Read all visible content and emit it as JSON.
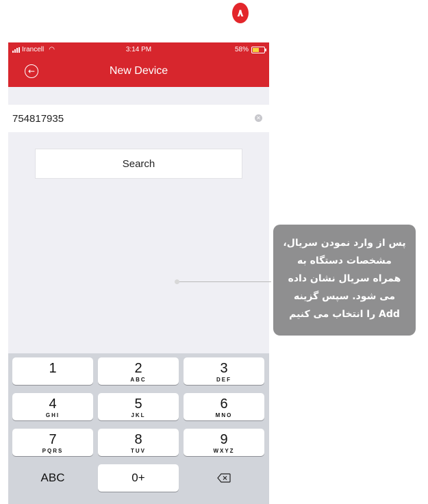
{
  "step_badge": "۸",
  "status_bar": {
    "carrier": "Irancell",
    "time": "3:14 PM",
    "battery": "58%",
    "battery_level": 0.58,
    "wifi_icon": "wifi-icon"
  },
  "nav": {
    "title": "New Device",
    "back_icon": "back-circle-icon"
  },
  "serial_input": {
    "value": "754817935"
  },
  "search_button": {
    "label": "Search"
  },
  "keyboard": {
    "keys": [
      {
        "num": "1",
        "letters": ""
      },
      {
        "num": "2",
        "letters": "ABC"
      },
      {
        "num": "3",
        "letters": "DEF"
      },
      {
        "num": "4",
        "letters": "GHI"
      },
      {
        "num": "5",
        "letters": "JKL"
      },
      {
        "num": "6",
        "letters": "MNO"
      },
      {
        "num": "7",
        "letters": "PQRS"
      },
      {
        "num": "8",
        "letters": "TUV"
      },
      {
        "num": "9",
        "letters": "WXYZ"
      }
    ],
    "abc_label": "ABC",
    "zero_label": "0+",
    "backspace_icon": "backspace-icon"
  },
  "callout": {
    "lines": [
      "پس از وارد نمودن سریال،",
      "مشخصات دستگاه به",
      "همراه سریال نشان داده",
      "می شود. سپس گزینه",
      "Add را انتخاب می کنیم"
    ]
  },
  "colors": {
    "brand_red": "#d7262d",
    "callout_gray": "#8f8f90"
  }
}
